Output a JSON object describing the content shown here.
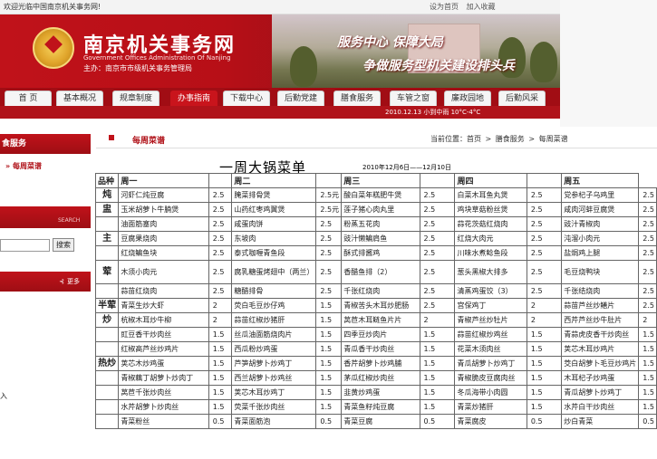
{
  "topbar": {
    "welcome": "欢迎光临中国南京机关事务网!",
    "set_home": "设为首页",
    "favorite": "加入收藏"
  },
  "banner": {
    "title": "南京机关事务网",
    "en": "Government Offices Administration Of Nanjing",
    "host": "主办：南京市市级机关事务管理局",
    "slogan1": "服务中心  保障大局",
    "slogan2": "争做服务型机关建设排头兵"
  },
  "nav": {
    "tabs": [
      "首  页",
      "基本概况",
      "规章制度",
      "办事指南",
      "下载中心",
      "后勤党建",
      "膳食服务",
      "车管之窗",
      "廉政园地",
      "后勤风采"
    ],
    "active_index": 3
  },
  "datebar": {
    "date": "2010.12.13",
    "weather": "小到中雨",
    "temp": "10°C-4°C"
  },
  "sidebar": {
    "section": "食服务",
    "link": "每周菜谱",
    "search_label": "SEARCH",
    "search_button": "搜索",
    "more": "更多",
    "input_label": "入"
  },
  "main": {
    "section_title": "每周菜谱",
    "breadcrumb": [
      "当前位置：首页",
      ">",
      "膳食服务",
      ">",
      "每周菜谱"
    ],
    "menu_title": "一周大锅菜单",
    "date_range": "2010年12月6日——12月10日",
    "headers": [
      "品种",
      "周一",
      "",
      "周二",
      "",
      "周三",
      "",
      "周四",
      "",
      "周五"
    ],
    "rows": [
      {
        "cat": "炖",
        "rowspan": 1,
        "dishes": [
          [
            "河虾仁炖豆腐",
            "2.5"
          ],
          [
            "腌菜排骨煲",
            "2.5元"
          ],
          [
            "酸白菜年糕肥牛煲",
            "2.5"
          ],
          [
            "白菜木耳鱼丸煲",
            "2.5"
          ],
          [
            "党参杞子乌鸡里",
            "2.5"
          ]
        ]
      },
      {
        "cat": "盅",
        "rowspan": 1,
        "dishes": [
          [
            "玉米胡萝卜牛腩煲",
            "2.5"
          ],
          [
            "山药红枣鸡翼煲",
            "2.5元"
          ],
          [
            "莲子猪心肉丸里",
            "2.5"
          ],
          [
            "鸡块草菇粉丝煲",
            "2.5"
          ],
          [
            "咸肉河蚌豆腐煲",
            "2.5"
          ]
        ]
      },
      {
        "cat": "",
        "rowspan": 1,
        "dishes": [
          [
            "油面筋塞肉",
            "2.5"
          ],
          [
            "咸蛋肉饼",
            "2.5"
          ],
          [
            "粉蒸五花肉",
            "2.5"
          ],
          [
            "蒜花茨菇红烧肉",
            "2.5"
          ],
          [
            "豉汁青椒肉",
            "2.5"
          ]
        ]
      },
      {
        "cat": "主",
        "rowspan": 1,
        "dishes": [
          [
            "豆腐果烧肉",
            "2.5"
          ],
          [
            "东坡肉",
            "2.5"
          ],
          [
            "豉汁懒鳊肩鱼",
            "2.5"
          ],
          [
            "红烧大肉元",
            "2.5"
          ],
          [
            "沌溜小肉元",
            "2.5"
          ]
        ]
      },
      {
        "cat": "",
        "rowspan": 1,
        "dishes": [
          [
            "红烧鳊鱼块",
            "2.5"
          ],
          [
            "泰式咖喱青鱼段",
            "2.5"
          ],
          [
            "酥式排酱鸡",
            "2.5"
          ],
          [
            "川味水煮鲶鱼段",
            "2.5"
          ],
          [
            "盐焗鸡上腿",
            "2.5"
          ]
        ]
      },
      {
        "cat": "荤",
        "rowspan": 1,
        "dishes": [
          [
            "木须小肉元",
            "2.5"
          ],
          [
            "腐乳糖蛋烤翅中（两兰）",
            "2.5"
          ],
          [
            "香醋鱼排（2）",
            "2.5"
          ],
          [
            "葱头黑椒大排多",
            "2.5"
          ],
          [
            "毛豆烧鸭块",
            "2.5"
          ]
        ]
      },
      {
        "cat": "",
        "rowspan": 1,
        "dishes": [
          [
            "蒜苗红烧肉",
            "2.5"
          ],
          [
            "糖醋排骨",
            "2.5"
          ],
          [
            "千张红烧肉",
            "2.5"
          ],
          [
            "清蒸鸡蛋饺（3）",
            "2.5"
          ],
          [
            "千张结烧肉",
            "2.5"
          ]
        ]
      },
      {
        "cat": "半荤",
        "rowspan": 1,
        "dishes": [
          [
            "青菜生炒大虾",
            "2"
          ],
          [
            "荧白毛豆炒仔鸡",
            "1.5"
          ],
          [
            "青椒苦头木耳炒肥肠",
            "2.5"
          ],
          [
            "宫保鸡丁",
            "2"
          ],
          [
            "蒜苗芦丝炒鳝片",
            "2.5"
          ]
        ]
      },
      {
        "cat": "炒",
        "rowspan": 1,
        "dishes": [
          [
            "杭椒木耳炒牛柳",
            "2"
          ],
          [
            "蒜苗红椒炒猪肝",
            "1.5"
          ],
          [
            "莴苣木耳鲢鱼片片",
            "2"
          ],
          [
            "青椒芦丝炒牡片",
            "2"
          ],
          [
            "西芹芦丝炒牛肚片",
            "2"
          ]
        ]
      },
      {
        "cat": "",
        "rowspan": 1,
        "dishes": [
          [
            "豇豆香干炒肉丝",
            "1.5"
          ],
          [
            "丝瓜油面筋烧肉片",
            "1.5"
          ],
          [
            "四季豆炒肉片",
            "1.5"
          ],
          [
            "蒜苗红椒炒鸡丝",
            "1.5"
          ],
          [
            "青蒜虎皮香干炒肉丝",
            "1.5"
          ]
        ]
      },
      {
        "cat": "",
        "rowspan": 1,
        "dishes": [
          [
            "红椒高芦丝炒鸡片",
            "1.5"
          ],
          [
            "西瓜粉炒鸡蛋",
            "1.5"
          ],
          [
            "青瓜香干炒肉丝",
            "1.5"
          ],
          [
            "花菜木须肉丝",
            "1.5"
          ],
          [
            "荚芯木耳炒鸡片",
            "1.5"
          ]
        ]
      },
      {
        "cat": "热炒",
        "rowspan": 1,
        "dishes": [
          [
            "荚芯木炒鸡蛋",
            "1.5"
          ],
          [
            "芦笋胡萝卜炒鸡丁",
            "1.5"
          ],
          [
            "香芹胡萝卜炒鸡脯",
            "1.5"
          ],
          [
            "青瓜胡萝卜炒鸡丁",
            "1.5"
          ],
          [
            "茭白胡萝卜毛豆炒鸡片",
            "1.5"
          ]
        ]
      },
      {
        "cat": "",
        "rowspan": 1,
        "dishes": [
          [
            "青椒藕丁胡萝卜炒肉丁",
            "1.5"
          ],
          [
            "西兰胡萝卜炒鸡丝",
            "1.5"
          ],
          [
            "茅瓜红椒炒肉丝",
            "1.5"
          ],
          [
            "青椒脆皮豆腐肉丝",
            "1.5"
          ],
          [
            "木耳杞子炒鸡蛋",
            "1.5"
          ]
        ]
      },
      {
        "cat": "",
        "rowspan": 1,
        "dishes": [
          [
            "莴苣千张炒肉丝",
            "1.5"
          ],
          [
            "荚芯木耳炒鸡丁",
            "1.5"
          ],
          [
            "韭黄炒鸡蛋",
            "1.5"
          ],
          [
            "冬瓜海带小肉圆",
            "1.5"
          ],
          [
            "青瓜胡萝卜炒鸡丁",
            "1.5"
          ]
        ]
      },
      {
        "cat": "",
        "rowspan": 1,
        "dishes": [
          [
            "水芹胡萝卜炒肉丝",
            "1.5"
          ],
          [
            "荧菜千张炒肉丝",
            "1.5"
          ],
          [
            "青菜鱼籽炖豆腐",
            "1.5"
          ],
          [
            "青菜炒猪肝",
            "1.5"
          ],
          [
            "水芹白干炒肉丝",
            "1.5"
          ]
        ]
      },
      {
        "cat": "",
        "rowspan": 1,
        "dishes": [
          [
            "青菜粉丝",
            "0.5"
          ],
          [
            "青菜面筋泡",
            "0.5"
          ],
          [
            "青菜豆腐",
            "0.5"
          ],
          [
            "青菜腐皮",
            "0.5"
          ],
          [
            "炒白青菜",
            "0.5"
          ]
        ]
      }
    ]
  }
}
